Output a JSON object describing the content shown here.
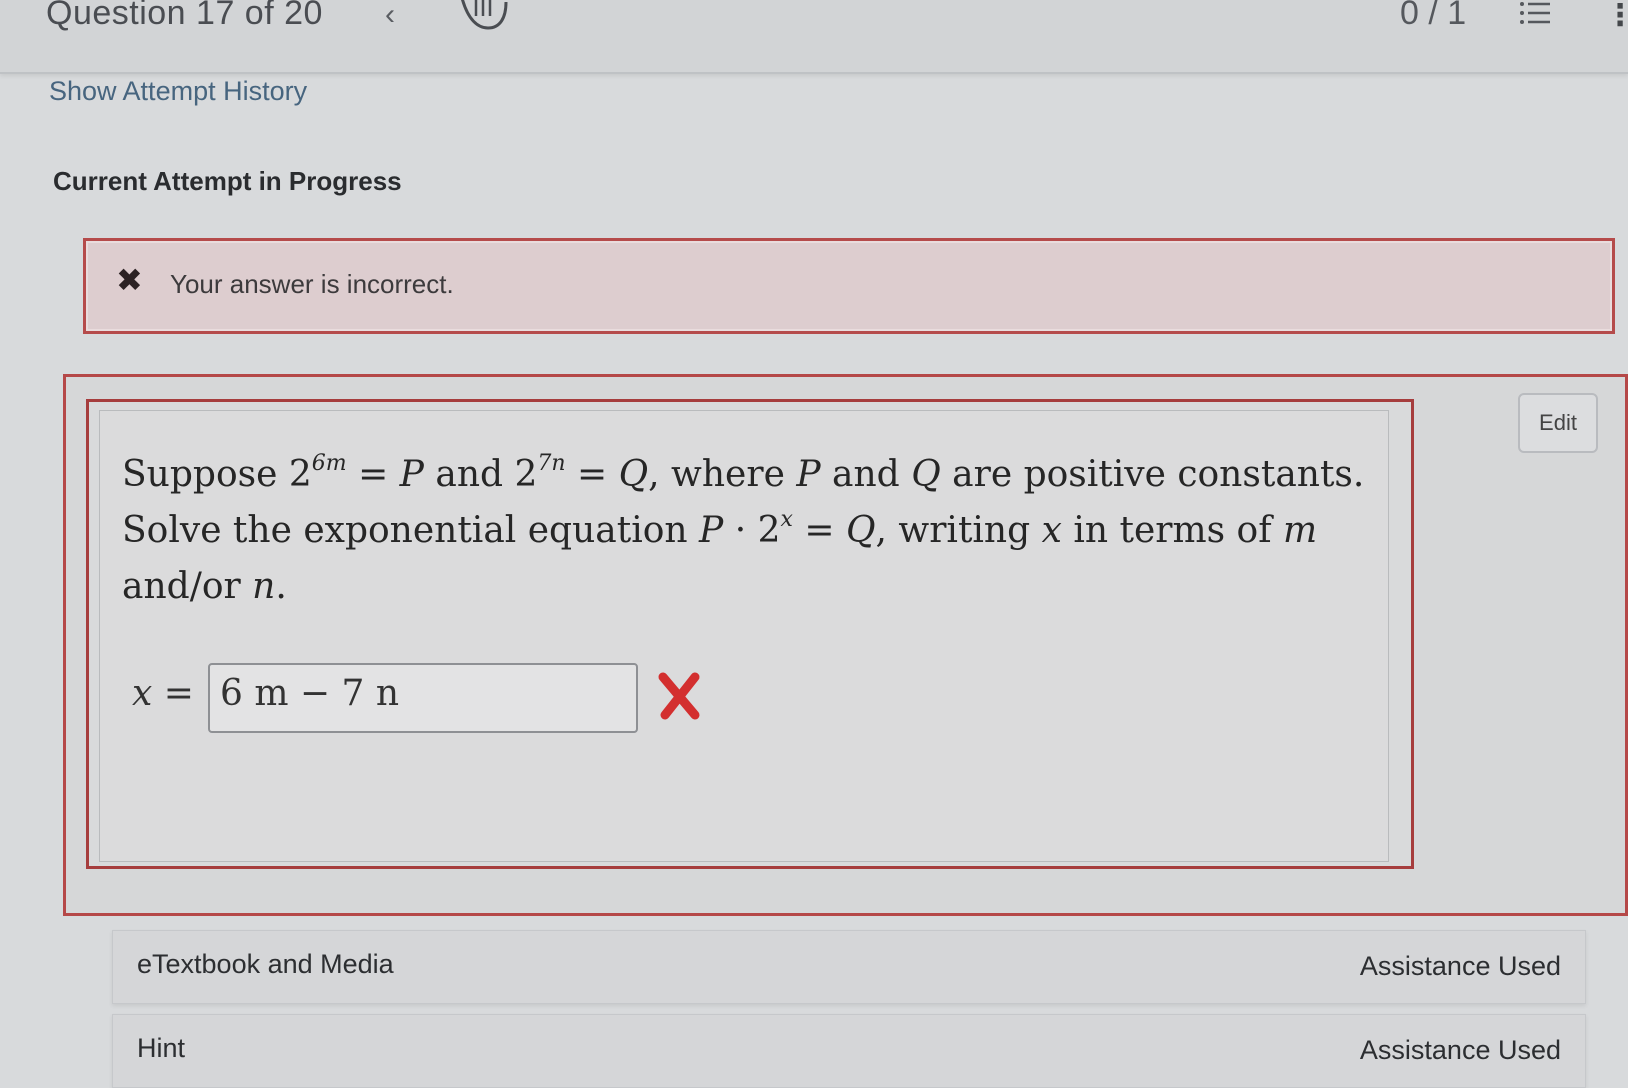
{
  "header": {
    "question_counter": "Question 17 of 20",
    "score": "0 / 1"
  },
  "history_link": "Show Attempt History",
  "attempt_title": "Current Attempt in Progress",
  "feedback": {
    "message": "Your answer is incorrect."
  },
  "question": {
    "line1": {
      "suppose": "Suppose",
      "base1": "2",
      "exp1": "6m",
      "eq1": "= ",
      "P": "P",
      "and1": "and",
      "base2": "2",
      "exp2": "7n",
      "eq2": "= ",
      "Q": "Q",
      "rest": ", where",
      "P2": "P",
      "and2": "and",
      "Q2": "Q",
      "tail": "are positive constants."
    },
    "line2": {
      "start": "Solve the exponential equation",
      "P": "P",
      "dot": "· 2",
      "exp": "x",
      "eq": "= ",
      "Q": "Q",
      "mid": ", writing",
      "x": "x",
      "end": "in terms of",
      "m": "m"
    },
    "line3": {
      "start": "and/or",
      "n": "n",
      "end": "."
    },
    "answer_label": "x =",
    "answer_value": "6 m − 7 n"
  },
  "edit_label": "Edit",
  "bottom": {
    "etextbook_label": "eTextbook and Media",
    "etextbook_status": "Assistance Used",
    "hint_label": "Hint",
    "hint_status": "Assistance Used"
  },
  "colors": {
    "error_border": "#b54b4b",
    "error_bg": "#ddcdcf",
    "wrong_mark": "#d32f2f",
    "link": "#47657f"
  },
  "icons": [
    "chevron-left-icon",
    "hand-icon",
    "list-icon",
    "more-vertical-icon",
    "close-icon",
    "wrong-mark-icon"
  ]
}
